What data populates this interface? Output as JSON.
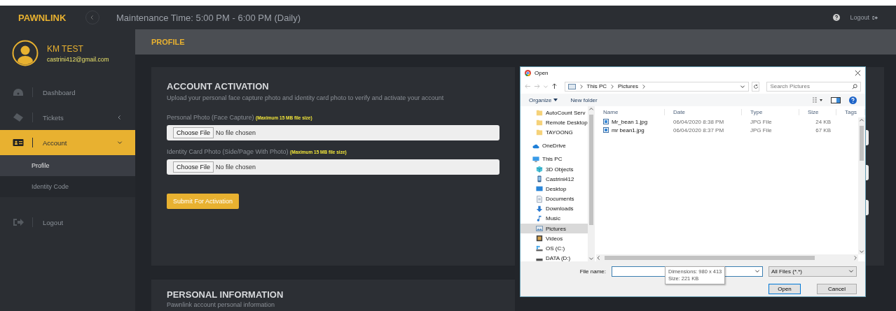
{
  "topbar": {
    "brand": "PAWNLINK",
    "maintenance": "Maintenance Time: 5:00 PM - 6:00 PM (Daily)",
    "logout": "Logout"
  },
  "user": {
    "name": "KM TEST",
    "email": "castrini412@gmail.com"
  },
  "sidebar": {
    "items": [
      {
        "label": "Dashboard",
        "selected": false
      },
      {
        "label": "Tickets",
        "selected": false,
        "expanded": false
      },
      {
        "label": "Account",
        "selected": true,
        "expanded": true,
        "children": [
          {
            "label": "Profile",
            "selected": true
          },
          {
            "label": "Identity Code",
            "selected": false
          }
        ]
      },
      {
        "label": "Logout",
        "selected": false
      }
    ]
  },
  "page_title": "PROFILE",
  "activation": {
    "title": "ACCOUNT ACTIVATION",
    "subtitle": "Upload your personal face capture photo and identity card photo to verify and activate your account",
    "fields": [
      {
        "label": "Personal Photo (Face Capture)",
        "note": "(Maximum 15 MB file size)",
        "button": "Choose File",
        "status": "No file chosen"
      },
      {
        "label": "Identity Card Photo (Side/Page With Photo)",
        "note": "(Maximum 15 MB file size)",
        "button": "Choose File",
        "status": "No file chosen"
      }
    ],
    "submit": "Submit For Activation"
  },
  "personal": {
    "title": "PERSONAL INFORMATION",
    "subtitle": "Pawnlink account personal information"
  },
  "dialog": {
    "title": "Open",
    "path": [
      "This PC",
      "Pictures"
    ],
    "search_placeholder": "Search Pictures",
    "toolbar": [
      "Organize",
      "New folder"
    ],
    "nav_quick": [
      {
        "label": "AutoCount Serv",
        "selected": false
      },
      {
        "label": "Remote Desktop",
        "selected": false
      },
      {
        "label": "TAYOONG",
        "selected": false
      }
    ],
    "nav": [
      {
        "label": "OneDrive",
        "selected": false
      },
      {
        "label": "This PC",
        "selected": false,
        "children": [
          {
            "label": "3D Objects",
            "selected": false
          },
          {
            "label": "Castrini412",
            "selected": false
          },
          {
            "label": "Desktop",
            "selected": false
          },
          {
            "label": "Documents",
            "selected": false
          },
          {
            "label": "Downloads",
            "selected": false
          },
          {
            "label": "Music",
            "selected": false
          },
          {
            "label": "Pictures",
            "selected": true
          },
          {
            "label": "Videos",
            "selected": false
          },
          {
            "label": "OS (C:)",
            "selected": false
          },
          {
            "label": "DATA (D:)",
            "selected": false
          }
        ]
      }
    ],
    "columns": [
      "Name",
      "Date",
      "Type",
      "Size",
      "Tags"
    ],
    "files": [
      {
        "name": "Mr_bean 1.jpg",
        "date": "06/04/2020 8:38 PM",
        "type": "JPG File",
        "size": "24 KB"
      },
      {
        "name": "mr bean1.jpg",
        "date": "06/04/2020 8:37 PM",
        "type": "JPG File",
        "size": "67 KB"
      }
    ],
    "tooltip": [
      "Dimensions: 980 x 413",
      "Size: 221 KB"
    ],
    "filename_label": "File name:",
    "filter": "All Files (*.*)",
    "buttons": [
      "Open",
      "Cancel"
    ]
  }
}
